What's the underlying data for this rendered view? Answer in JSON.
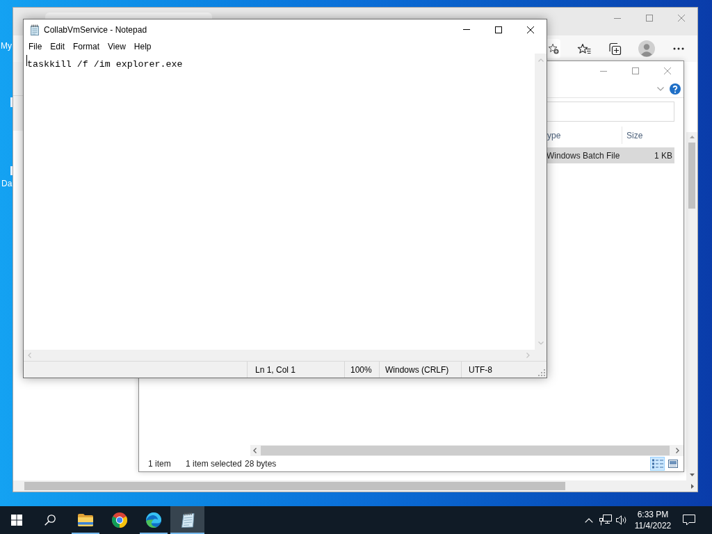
{
  "notepad": {
    "title": "CollabVmService - Notepad",
    "menu": [
      "File",
      "Edit",
      "Format",
      "View",
      "Help"
    ],
    "content": "taskkill /f /im explorer.exe",
    "status_bar": [
      "Ln 1, Col 1",
      "100%",
      "Windows (CRLF)",
      "UTF-8"
    ]
  },
  "file_explorer": {
    "columns": [
      "ype",
      "Size"
    ],
    "rows": [
      {
        "type": "Windows Batch File",
        "size": "1 KB",
        "selected": true
      }
    ],
    "status_bar": {
      "item_count": "1 item",
      "selection": "1 item selected",
      "selection_size": "28 bytes"
    },
    "view_buttons": [
      {
        "kind": "details",
        "selected": true
      },
      {
        "kind": "large-icons",
        "selected": false
      }
    ]
  },
  "desktop": {
    "icon_labels": [
      "My",
      "Da"
    ]
  },
  "taskbar": {
    "apps": [
      {
        "kind": "file-explorer",
        "running": true,
        "active": false
      },
      {
        "kind": "chrome",
        "running": false,
        "active": false
      },
      {
        "kind": "edge",
        "running": true,
        "active": false
      },
      {
        "kind": "notepad",
        "running": true,
        "active": true
      }
    ],
    "clock": {
      "time": "6:33 PM",
      "date": "11/4/2022"
    }
  }
}
